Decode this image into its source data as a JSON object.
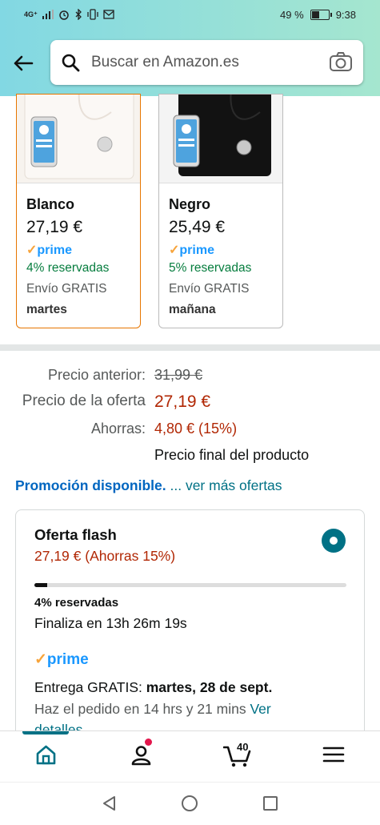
{
  "status_bar": {
    "network": "4G⁺",
    "battery": "49 %",
    "battery_level": 0.49,
    "time": "9:38"
  },
  "search": {
    "placeholder": "Buscar en Amazon.es"
  },
  "variants": [
    {
      "name": "Blanco",
      "price": "27,19 €",
      "prime": "prime",
      "reserved": "4% reservadas",
      "shipping": "Envío GRATIS",
      "delivery_day": "martes",
      "selected": true
    },
    {
      "name": "Negro",
      "price": "25,49 €",
      "prime": "prime",
      "reserved": "5% reservadas",
      "shipping": "Envío GRATIS",
      "delivery_day": "mañana",
      "selected": false
    }
  ],
  "pricing": {
    "previous_label": "Precio anterior:",
    "previous_value": "31,99 €",
    "deal_label": "Precio de la oferta",
    "deal_value": "27,19 €",
    "savings_label": "Ahorras:",
    "savings_value": "4,80 € (15%)",
    "final_note": "Precio final del producto"
  },
  "promo": {
    "label": "Promoción disponible.",
    "link": "... ver más ofertas"
  },
  "flash_offer": {
    "title": "Oferta flash",
    "subtitle": "27,19 € (Ahorras 15%)",
    "reserved_percent": 4,
    "reserved_text": "4% reservadas",
    "ends_text": "Finaliza en 13h 26m 19s",
    "prime": "prime",
    "delivery_prefix": "Entrega GRATIS: ",
    "delivery_date": "martes, 28 de sept.",
    "order_text": "Haz el pedido en 14 hrs y 21 mins ",
    "order_link": "Ver",
    "order_link_2": "detalles"
  },
  "bottom_nav": {
    "cart_count": "40"
  },
  "colors": {
    "accent": "#007185",
    "price_red": "#b12704",
    "prime_blue": "#1a98ff",
    "green": "#067d3e",
    "selected_border": "#e77600"
  }
}
